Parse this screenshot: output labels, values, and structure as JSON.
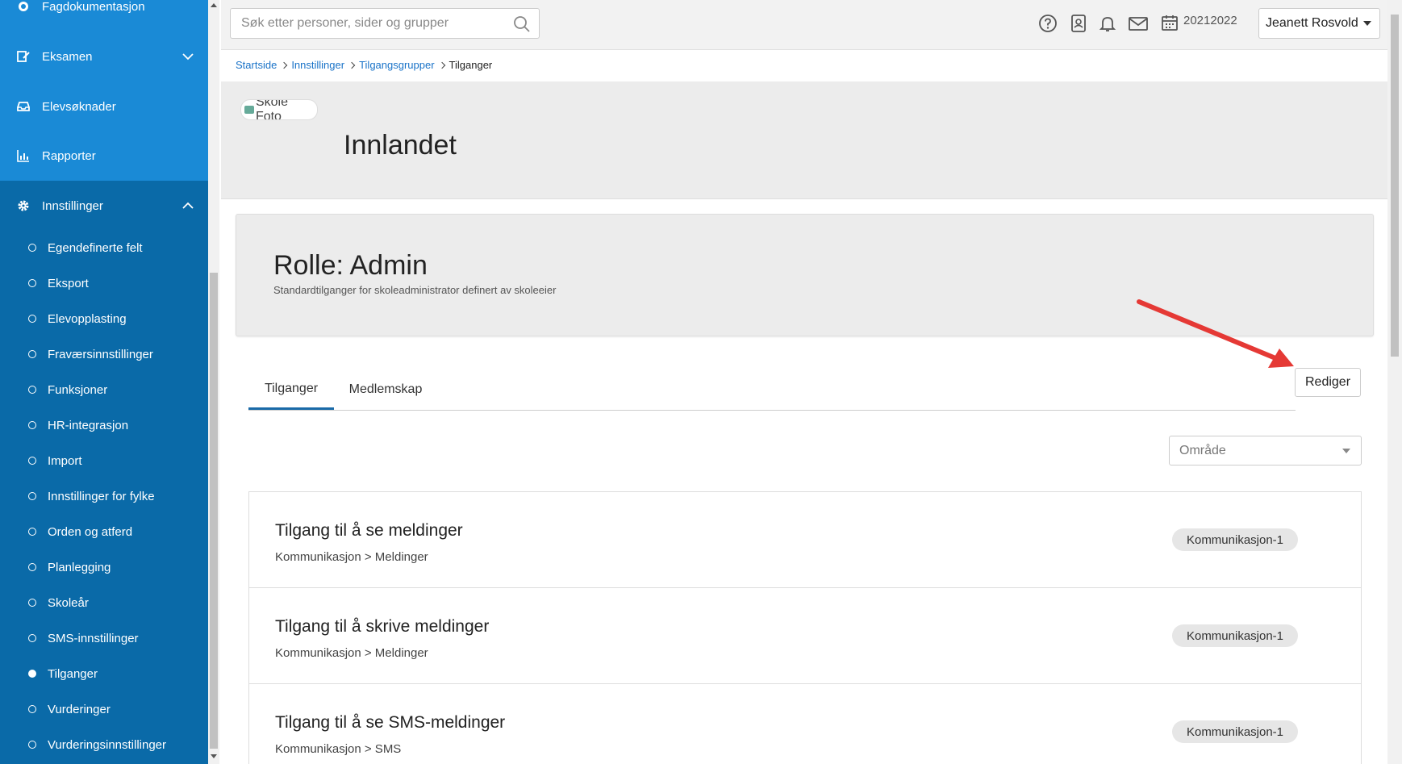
{
  "sidebar": {
    "top_items": [
      {
        "label": "Fagdokumentasjon",
        "icon": "badge-icon"
      },
      {
        "label": "Eksamen",
        "icon": "edit-icon",
        "chevron": "down"
      },
      {
        "label": "Elevsøknader",
        "icon": "inbox-icon"
      },
      {
        "label": "Rapporter",
        "icon": "bar-chart-icon"
      },
      {
        "label": "Innstillinger",
        "icon": "gear-icon",
        "chevron": "up"
      }
    ],
    "sub_items": [
      {
        "label": "Egendefinerte felt"
      },
      {
        "label": "Eksport"
      },
      {
        "label": "Elevopplasting"
      },
      {
        "label": "Fraværsinnstillinger"
      },
      {
        "label": "Funksjoner"
      },
      {
        "label": "HR-integrasjon"
      },
      {
        "label": "Import"
      },
      {
        "label": "Innstillinger for fylke"
      },
      {
        "label": "Orden og atferd"
      },
      {
        "label": "Planlegging"
      },
      {
        "label": "Skoleår"
      },
      {
        "label": "SMS-innstillinger"
      },
      {
        "label": "Tilganger",
        "active": true
      },
      {
        "label": "Vurderinger"
      },
      {
        "label": "Vurderingsinnstillinger"
      }
    ]
  },
  "topbar": {
    "search_placeholder": "Søk etter personer, sider og grupper",
    "school_year": "20212022",
    "user_name": "Jeanett Rosvold"
  },
  "breadcrumb": {
    "items": [
      "Startside",
      "Innstillinger",
      "Tilgangsgrupper"
    ],
    "current": "Tilganger"
  },
  "school": {
    "photo_alt": "Skole Foto",
    "name": "Innlandet"
  },
  "role": {
    "title": "Rolle: Admin",
    "description": "Standardtilganger for skoleadministrator definert av skoleeier"
  },
  "actions": {
    "edit_label": "Rediger"
  },
  "tabs": [
    {
      "label": "Tilganger",
      "active": true
    },
    {
      "label": "Medlemskap",
      "active": false
    }
  ],
  "filter": {
    "area_placeholder": "Område"
  },
  "permissions": [
    {
      "title": "Tilgang til å se meldinger",
      "path": "Kommunikasjon > Meldinger",
      "badge": "Kommunikasjon-1"
    },
    {
      "title": "Tilgang til å skrive meldinger",
      "path": "Kommunikasjon > Meldinger",
      "badge": "Kommunikasjon-1"
    },
    {
      "title": "Tilgang til å se SMS-meldinger",
      "path": "Kommunikasjon > SMS",
      "badge": "Kommunikasjon-1"
    }
  ],
  "colors": {
    "sidebar_top": "#1a8ad6",
    "sidebar": "#0a6aa8",
    "annotation_arrow": "#e53935",
    "link": "#1a73c8"
  }
}
